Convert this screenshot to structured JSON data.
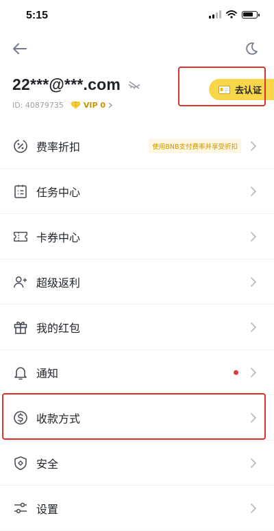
{
  "status_bar": {
    "time": "5:15"
  },
  "account": {
    "email": "22***@***.com",
    "user_id": "ID: 40879735",
    "vip": "VIP 0",
    "verify_label": "去认证"
  },
  "menu": {
    "items": [
      {
        "label": "费率折扣",
        "icon": "fee-discount-icon",
        "promo": "使用BNB支付费率并享受折扣"
      },
      {
        "label": "任务中心",
        "icon": "task-center-icon"
      },
      {
        "label": "卡券中心",
        "icon": "coupon-icon"
      },
      {
        "label": "超级返利",
        "icon": "referral-icon"
      },
      {
        "label": "我的红包",
        "icon": "gift-icon"
      },
      {
        "label": "通知",
        "icon": "bell-icon",
        "has_dot": true
      },
      {
        "label": "收款方式",
        "icon": "dollar-circle-icon"
      },
      {
        "label": "安全",
        "icon": "shield-icon"
      },
      {
        "label": "设置",
        "icon": "settings-sliders-icon"
      }
    ]
  },
  "colors": {
    "accent": "#f7d64a",
    "vip_gold": "#c99400",
    "highlight_red": "#d9342b",
    "dot_red": "#e0383a"
  }
}
